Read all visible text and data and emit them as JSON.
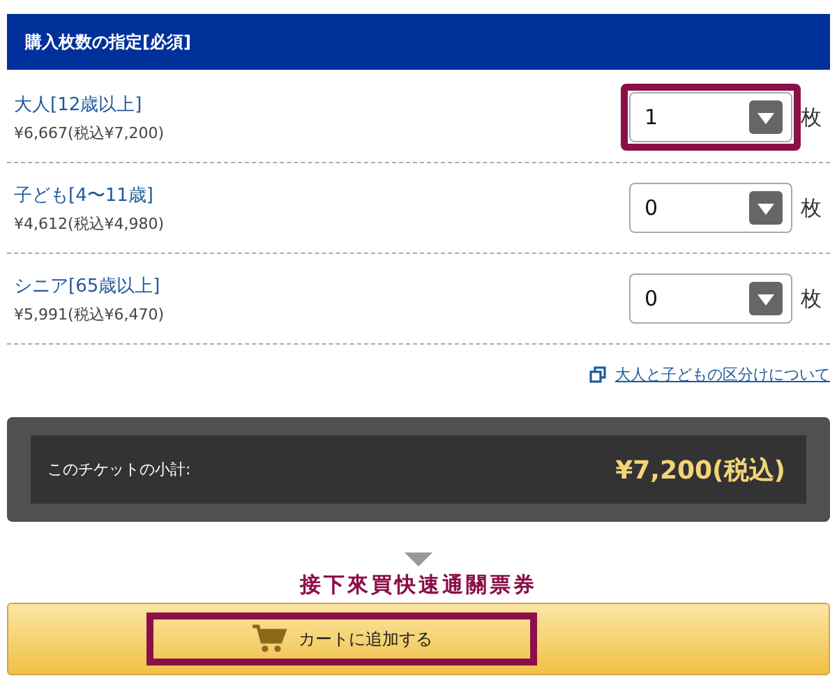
{
  "section": {
    "title": "購入枚数の指定[必須]"
  },
  "tickets": [
    {
      "name": "大人[12歳以上]",
      "price": "¥6,667(税込¥7,200)",
      "quantity": "1",
      "unit": "枚",
      "highlighted": true
    },
    {
      "name": "子ども[4〜11歳]",
      "price": "¥4,612(税込¥4,980)",
      "quantity": "0",
      "unit": "枚",
      "highlighted": false
    },
    {
      "name": "シニア[65歳以上]",
      "price": "¥5,991(税込¥6,470)",
      "quantity": "0",
      "unit": "枚",
      "highlighted": false
    }
  ],
  "info_link": "大人と子どもの区分けについて",
  "subtotal": {
    "label": "このチケットの小計:",
    "amount": "¥7,200(税込)"
  },
  "annotation": "接下來買快速通關票券",
  "cart_button": {
    "label": "カートに追加する",
    "highlighted": true
  }
}
